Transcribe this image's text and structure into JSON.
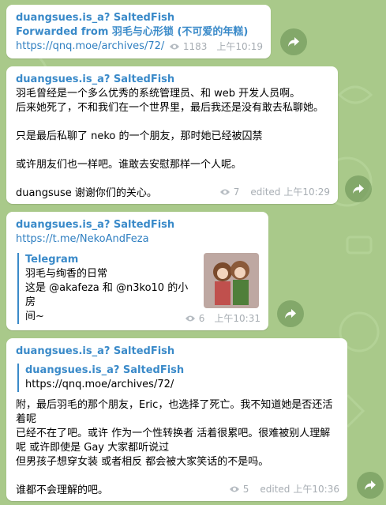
{
  "messages": [
    {
      "sender": "duangsues.is_a? SaltedFish",
      "forwarded": "Forwarded from 羽毛与心形锁 (不可爱的年糕)",
      "link": "https://qnq.moe/archives/72/",
      "views": "1183",
      "time": "上午10:19"
    },
    {
      "sender": "duangsues.is_a? SaltedFish",
      "text": "羽毛曾经是一个多么优秀的系统管理员、和 web 开发人员啊。\n后来她死了，不和我们在一个世界里，最后我还是没有敢去私聊她。\n\n只是最后私聊了 neko 的一个朋友，那时她已经被囚禁\n\n或许朋友们也一样吧。谁敢去安慰那样一个人呢。\n\nduangsuse 谢谢你们的关心。",
      "views": "7",
      "edited": "edited",
      "time": "上午10:29"
    },
    {
      "sender": "duangsues.is_a? SaltedFish",
      "link": "https://t.me/NekoAndFeza",
      "preview": {
        "site": "Telegram",
        "title": "羽毛与绚香的日常",
        "desc": "这是 @akafeza 和 @n3ko10 的小房\n间~"
      },
      "views": "6",
      "time": "上午10:31"
    },
    {
      "sender": "duangsues.is_a? SaltedFish",
      "reply": {
        "title": "duangsues.is_a? SaltedFish",
        "text": "https://qnq.moe/archives/72/"
      },
      "text": "附，最后羽毛的那个朋友，Eric，也选择了死亡。我不知道她是否还活\n着呢\n已经不在了吧。或许 作为一个性转换者 活着很累吧。很难被别人理解\n呢 或许即使是 Gay 大家都听说过\n但男孩子想穿女装 或者相反 都会被大家笑话的不是吗。\n\n谁都不会理解的吧。",
      "views": "5",
      "edited": "edited",
      "time": "上午10:36"
    }
  ],
  "icons": {
    "share": "share-arrow-icon",
    "views": "eye-icon"
  },
  "colors": {
    "background": "#a9c98a",
    "accent": "#3a8ac9",
    "meta": "#a7adb3"
  }
}
